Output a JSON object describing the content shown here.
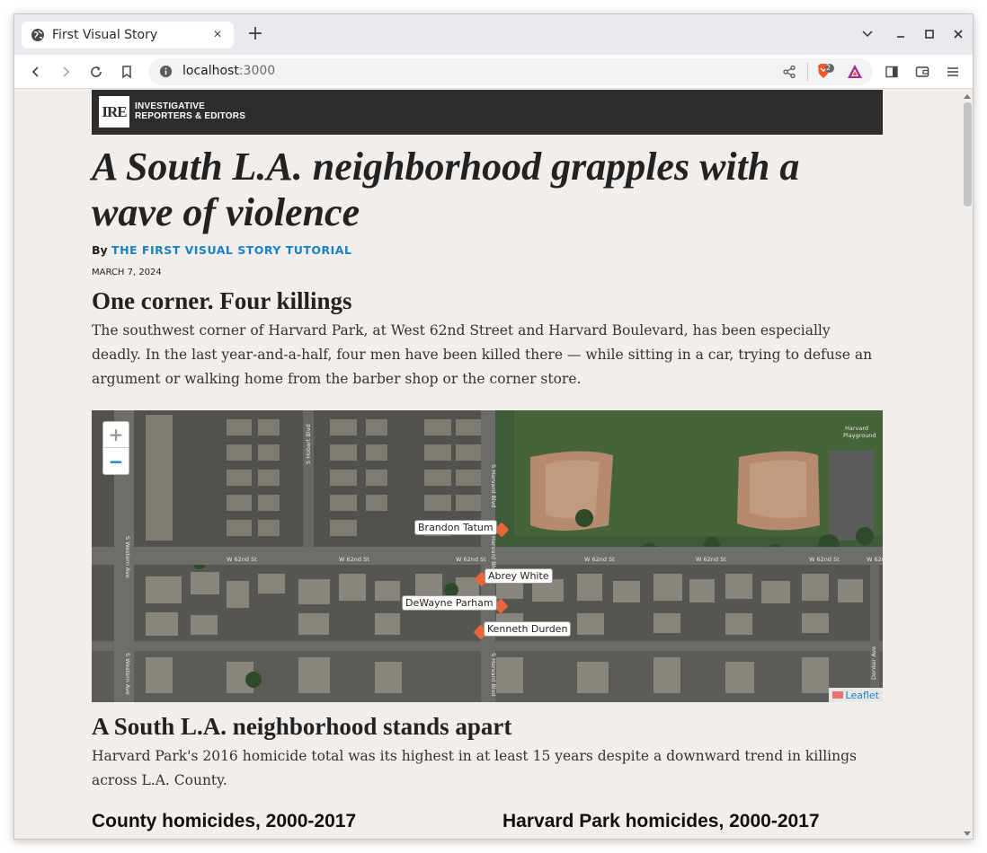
{
  "browser": {
    "tab_title": "First Visual Story",
    "new_tab_label": "+",
    "close_tab_label": "×",
    "url_host": "localhost",
    "url_port": ":3000",
    "brave_badge_count": "2"
  },
  "page": {
    "banner": {
      "logo_text": "IRE",
      "org_line1": "INVESTIGATIVE",
      "org_line2": "REPORTERS & EDITORS"
    },
    "headline": "A South L.A. neighborhood grapples with a wave of violence",
    "byline_prefix": "By",
    "byline_author": "THE FIRST VISUAL STORY TUTORIAL",
    "date": "MARCH 7, 2024",
    "section1": {
      "heading": "One corner. Four killings",
      "body": "The southwest corner of Harvard Park, at West 62nd Street and Harvard Boulevard, has been especially deadly. In the last year-and-a-half, four men have been killed there — while sitting in a car, trying to defuse an argument or walking home from the barber shop or the corner store."
    },
    "map": {
      "zoom_in": "+",
      "zoom_out": "−",
      "victims": [
        "Brandon Tatum",
        "Abrey White",
        "DeWayne Parham",
        "Kenneth Durden"
      ],
      "attribution": "Leaflet",
      "street_labels": [
        "W 62nd St",
        "W 62nd St",
        "W 62nd St",
        "W 62nd St",
        "W 62nd St",
        "W 62nd St",
        "W 62nd St",
        "S Hobart Blvd",
        "S Harvard Blvd",
        "S Western Ave",
        "S Western Ave",
        "Harvard Blvd",
        "S Harvard Blvd",
        "Denker Ave",
        "Harvard Playground"
      ]
    },
    "section2": {
      "heading": "A South L.A. neighborhood stands apart",
      "body": "Harvard Park's 2016 homicide total was its highest in at least 15 years despite a downward trend in killings across L.A. County."
    },
    "charts": {
      "left_title": "County homicides, 2000-2017",
      "right_title": "Harvard Park homicides, 2000-2017"
    }
  },
  "colors": {
    "page_bg": "#f2eeeb",
    "banner_bg": "#2f2c2c",
    "link_blue": "#1a82c4",
    "marker_orange": "#e8663a"
  }
}
